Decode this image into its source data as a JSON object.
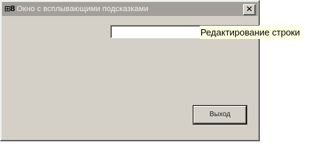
{
  "window": {
    "icon_glyph": "⊞8",
    "title": "Окно с всплывающими подсказками",
    "close_glyph": "✕"
  },
  "main": {
    "text_field_value": "",
    "tooltip_text": "Редактирование строки",
    "exit_button_label": "Выход"
  },
  "colors": {
    "window_bg": "#d4d0c8",
    "titlebar_bg": "#a29f9a",
    "tooltip_bg": "#ffffe1"
  }
}
